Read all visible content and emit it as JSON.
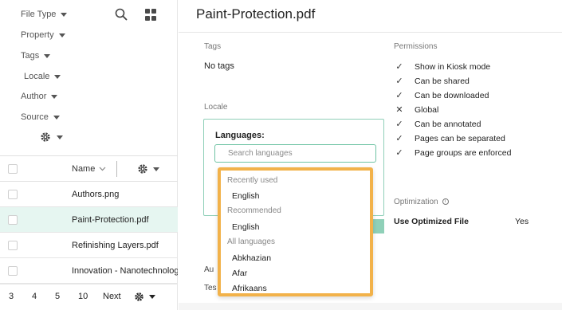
{
  "sidebar": {
    "filters": [
      "File Type",
      "Property",
      "Tags",
      "Locale",
      "Author",
      "Source"
    ],
    "list": {
      "column_name": "Name",
      "rows": [
        "Authors.png",
        "Paint-Protection.pdf",
        "Refinishing Layers.pdf",
        "Innovation - Nanotechnology"
      ],
      "selected_index": 1
    },
    "pagination": {
      "sizes": [
        "3",
        "4",
        "5",
        "10"
      ],
      "next_label": "Next"
    }
  },
  "detail": {
    "title": "Paint-Protection.pdf",
    "tags": {
      "label": "Tags",
      "value": "No tags"
    },
    "locale": {
      "label": "Locale",
      "languages_label": "Languages:",
      "search_placeholder": "Search languages"
    },
    "permissions": {
      "label": "Permissions",
      "items": [
        {
          "text": "Show in Kiosk mode",
          "enabled": true
        },
        {
          "text": "Can be shared",
          "enabled": true
        },
        {
          "text": "Can be downloaded",
          "enabled": true
        },
        {
          "text": "Global",
          "enabled": false
        },
        {
          "text": "Can be annotated",
          "enabled": true
        },
        {
          "text": "Pages can be separated",
          "enabled": true
        },
        {
          "text": "Page groups are enforced",
          "enabled": true
        }
      ]
    },
    "optimization": {
      "label": "Optimization",
      "field": "Use Optimized File",
      "value": "Yes"
    },
    "partial_labels": {
      "author": "Au",
      "text": "Tes"
    }
  },
  "language_dropdown": {
    "groups": [
      {
        "label": "Recently used",
        "items": [
          "English"
        ]
      },
      {
        "label": "Recommended",
        "items": [
          "English"
        ]
      },
      {
        "label": "All languages",
        "items": [
          "Abkhazian",
          "Afar",
          "Afrikaans"
        ]
      }
    ]
  },
  "colors": {
    "accent_green": "#6fc3a4",
    "highlight_orange": "#f2b24a",
    "selected_row": "#e6f6f1"
  }
}
